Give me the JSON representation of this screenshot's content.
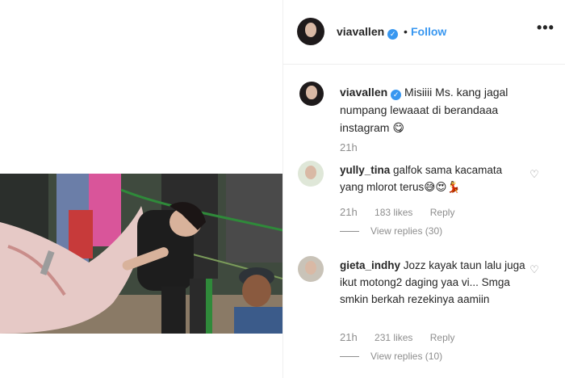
{
  "post": {
    "photo_alt": "photo"
  },
  "header": {
    "username": "viavallen",
    "separator": "•",
    "follow_label": "Follow",
    "more_icon": "•••"
  },
  "caption": {
    "username": "viavallen",
    "text": "Misiiii Ms. kang jagal numpang lewaaat di berandaaa instagram 😋",
    "time": "21h"
  },
  "comments": [
    {
      "username": "yully_tina",
      "text": "galfok sama kacamata yang mlorot terus😅😍💃",
      "time": "21h",
      "likes": "183 likes",
      "reply_label": "Reply",
      "view_replies": "View replies (30)"
    },
    {
      "username": "gieta_indhy",
      "text": "Jozz kayak taun lalu juga ikut motong2 daging yaa vi... Smga smkin berkah rezekinya aamiin",
      "time": "21h",
      "likes": "231 likes",
      "reply_label": "Reply",
      "view_replies": "View replies (10)"
    }
  ],
  "colors": {
    "link": "#3897f0",
    "secondary_text": "#8e8e8e",
    "primary_text": "#262626"
  }
}
